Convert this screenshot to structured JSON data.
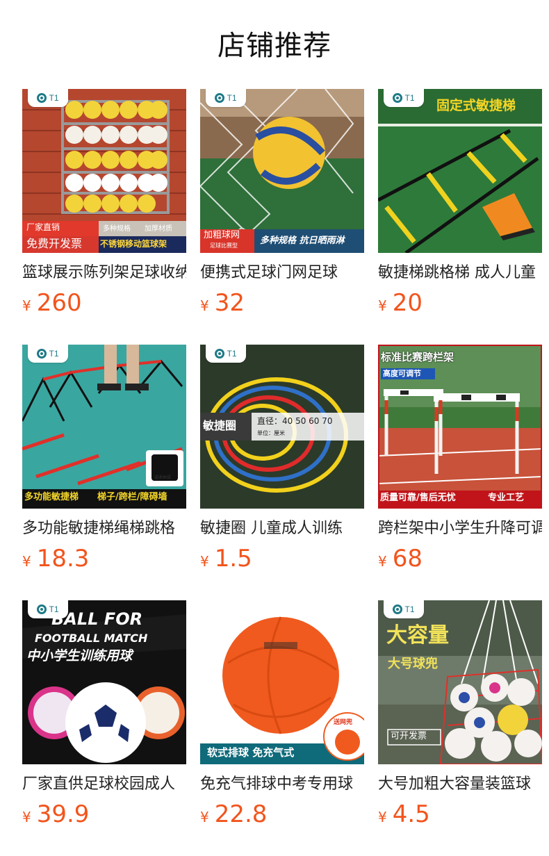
{
  "header": {
    "title": "店铺推荐"
  },
  "brand": {
    "logo_text": "T1"
  },
  "colors": {
    "price": "#f2541c",
    "brand": "#1f7a87"
  },
  "products": [
    {
      "name": "篮球展示陈列架足球收纳",
      "currency": "¥",
      "price": "260",
      "badges": [
        "厂家直销",
        "免费开发票",
        "多种规格",
        "加厚材质",
        "不锈钢移动篮球架"
      ]
    },
    {
      "name": "便携式足球门网足球",
      "currency": "¥",
      "price": "32",
      "badges": [
        "加粗球网",
        "足球比赛型",
        "多种规格 抗日晒雨淋"
      ]
    },
    {
      "name": "敏捷梯跳格梯 成人儿童",
      "currency": "¥",
      "price": "20",
      "badges": [
        "固定式敏捷梯"
      ]
    },
    {
      "name": "多功能敏捷梯绳梯跳格",
      "currency": "¥",
      "price": "18.3",
      "badges": [
        "多功能敏捷梯",
        "梯子/跨栏/障碍墙",
        "送收纳袋"
      ]
    },
    {
      "name": "敏捷圈 儿童成人训练",
      "currency": "¥",
      "price": "1.5",
      "badges": [
        "敏捷圈",
        "直径：40  50  60 70",
        "单位：厘米"
      ]
    },
    {
      "name": "跨栏架中小学生升降可调",
      "currency": "¥",
      "price": "68",
      "badges": [
        "标准比赛跨栏架",
        "高度可调节",
        "质量可靠/售后无忧",
        "专业工艺"
      ]
    },
    {
      "name": "厂家直供足球校园成人",
      "currency": "¥",
      "price": "39.9",
      "badges": [
        "BALL FOR",
        "FOOTBALL MATCH",
        "中小学生训练用球"
      ]
    },
    {
      "name": "免充气排球中考专用球",
      "currency": "¥",
      "price": "22.8",
      "badges": [
        "软式排球 免充气式",
        "送网兜"
      ]
    },
    {
      "name": "大号加粗大容量装篮球",
      "currency": "¥",
      "price": "4.5",
      "badges": [
        "大容量",
        "大号球兜",
        "可开发票"
      ]
    }
  ]
}
